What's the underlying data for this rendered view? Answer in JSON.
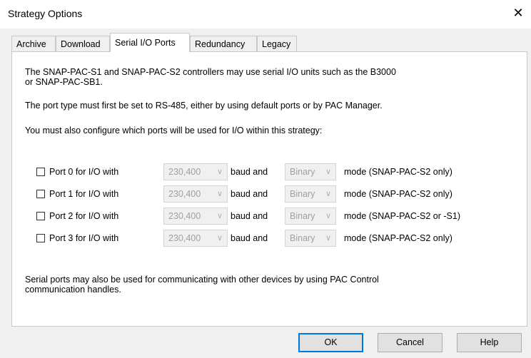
{
  "window": {
    "title": "Strategy Options",
    "close_icon": "close-icon"
  },
  "tabs": [
    {
      "label": "Archive"
    },
    {
      "label": "Download"
    },
    {
      "label": "Serial I/O Ports",
      "active": true
    },
    {
      "label": "Redundancy"
    },
    {
      "label": "Legacy"
    }
  ],
  "intro": {
    "line1": "The SNAP-PAC-S1 and SNAP-PAC-S2 controllers may use serial I/O units such as the B3000",
    "line2": "or SNAP-PAC-SB1.",
    "port_type": "The port type must first be set to RS-485, either by using default ports or by PAC Manager.",
    "configure": "You must also configure which ports will be used for I/O within this strategy:"
  },
  "ports": [
    {
      "label": "Port 0 for I/O with",
      "checked": false,
      "baud": "230,400",
      "baud_text": "baud and",
      "mode": "Binary",
      "mode_text": "mode  (SNAP-PAC-S2 only)"
    },
    {
      "label": "Port 1 for I/O with",
      "checked": false,
      "baud": "230,400",
      "baud_text": "baud and",
      "mode": "Binary",
      "mode_text": "mode  (SNAP-PAC-S2 only)"
    },
    {
      "label": "Port 2 for I/O with",
      "checked": false,
      "baud": "230,400",
      "baud_text": "baud and",
      "mode": "Binary",
      "mode_text": "mode  (SNAP-PAC-S2 or -S1)"
    },
    {
      "label": "Port 3 for I/O with",
      "checked": false,
      "baud": "230,400",
      "baud_text": "baud and",
      "mode": "Binary",
      "mode_text": "mode  (SNAP-PAC-S2 only)"
    }
  ],
  "footer_note": {
    "line1": "Serial ports may also be used for communicating with other devices by using PAC Control",
    "line2": "communication handles."
  },
  "buttons": {
    "ok": "OK",
    "cancel": "Cancel",
    "help": "Help"
  },
  "colors": {
    "default_button_border": "#0078d7",
    "disabled_text": "#a0a0a0"
  }
}
